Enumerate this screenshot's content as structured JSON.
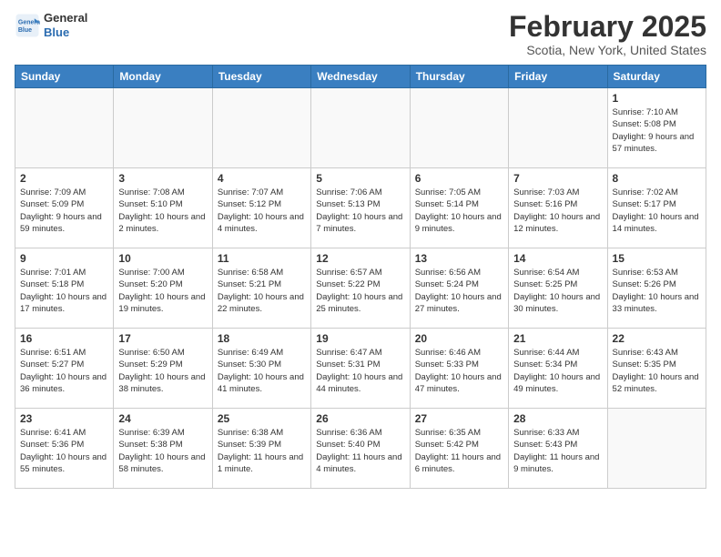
{
  "header": {
    "logo_line1": "General",
    "logo_line2": "Blue",
    "month_title": "February 2025",
    "location": "Scotia, New York, United States"
  },
  "weekdays": [
    "Sunday",
    "Monday",
    "Tuesday",
    "Wednesday",
    "Thursday",
    "Friday",
    "Saturday"
  ],
  "weeks": [
    [
      {
        "day": "",
        "info": ""
      },
      {
        "day": "",
        "info": ""
      },
      {
        "day": "",
        "info": ""
      },
      {
        "day": "",
        "info": ""
      },
      {
        "day": "",
        "info": ""
      },
      {
        "day": "",
        "info": ""
      },
      {
        "day": "1",
        "info": "Sunrise: 7:10 AM\nSunset: 5:08 PM\nDaylight: 9 hours and 57 minutes."
      }
    ],
    [
      {
        "day": "2",
        "info": "Sunrise: 7:09 AM\nSunset: 5:09 PM\nDaylight: 9 hours and 59 minutes."
      },
      {
        "day": "3",
        "info": "Sunrise: 7:08 AM\nSunset: 5:10 PM\nDaylight: 10 hours and 2 minutes."
      },
      {
        "day": "4",
        "info": "Sunrise: 7:07 AM\nSunset: 5:12 PM\nDaylight: 10 hours and 4 minutes."
      },
      {
        "day": "5",
        "info": "Sunrise: 7:06 AM\nSunset: 5:13 PM\nDaylight: 10 hours and 7 minutes."
      },
      {
        "day": "6",
        "info": "Sunrise: 7:05 AM\nSunset: 5:14 PM\nDaylight: 10 hours and 9 minutes."
      },
      {
        "day": "7",
        "info": "Sunrise: 7:03 AM\nSunset: 5:16 PM\nDaylight: 10 hours and 12 minutes."
      },
      {
        "day": "8",
        "info": "Sunrise: 7:02 AM\nSunset: 5:17 PM\nDaylight: 10 hours and 14 minutes."
      }
    ],
    [
      {
        "day": "9",
        "info": "Sunrise: 7:01 AM\nSunset: 5:18 PM\nDaylight: 10 hours and 17 minutes."
      },
      {
        "day": "10",
        "info": "Sunrise: 7:00 AM\nSunset: 5:20 PM\nDaylight: 10 hours and 19 minutes."
      },
      {
        "day": "11",
        "info": "Sunrise: 6:58 AM\nSunset: 5:21 PM\nDaylight: 10 hours and 22 minutes."
      },
      {
        "day": "12",
        "info": "Sunrise: 6:57 AM\nSunset: 5:22 PM\nDaylight: 10 hours and 25 minutes."
      },
      {
        "day": "13",
        "info": "Sunrise: 6:56 AM\nSunset: 5:24 PM\nDaylight: 10 hours and 27 minutes."
      },
      {
        "day": "14",
        "info": "Sunrise: 6:54 AM\nSunset: 5:25 PM\nDaylight: 10 hours and 30 minutes."
      },
      {
        "day": "15",
        "info": "Sunrise: 6:53 AM\nSunset: 5:26 PM\nDaylight: 10 hours and 33 minutes."
      }
    ],
    [
      {
        "day": "16",
        "info": "Sunrise: 6:51 AM\nSunset: 5:27 PM\nDaylight: 10 hours and 36 minutes."
      },
      {
        "day": "17",
        "info": "Sunrise: 6:50 AM\nSunset: 5:29 PM\nDaylight: 10 hours and 38 minutes."
      },
      {
        "day": "18",
        "info": "Sunrise: 6:49 AM\nSunset: 5:30 PM\nDaylight: 10 hours and 41 minutes."
      },
      {
        "day": "19",
        "info": "Sunrise: 6:47 AM\nSunset: 5:31 PM\nDaylight: 10 hours and 44 minutes."
      },
      {
        "day": "20",
        "info": "Sunrise: 6:46 AM\nSunset: 5:33 PM\nDaylight: 10 hours and 47 minutes."
      },
      {
        "day": "21",
        "info": "Sunrise: 6:44 AM\nSunset: 5:34 PM\nDaylight: 10 hours and 49 minutes."
      },
      {
        "day": "22",
        "info": "Sunrise: 6:43 AM\nSunset: 5:35 PM\nDaylight: 10 hours and 52 minutes."
      }
    ],
    [
      {
        "day": "23",
        "info": "Sunrise: 6:41 AM\nSunset: 5:36 PM\nDaylight: 10 hours and 55 minutes."
      },
      {
        "day": "24",
        "info": "Sunrise: 6:39 AM\nSunset: 5:38 PM\nDaylight: 10 hours and 58 minutes."
      },
      {
        "day": "25",
        "info": "Sunrise: 6:38 AM\nSunset: 5:39 PM\nDaylight: 11 hours and 1 minute."
      },
      {
        "day": "26",
        "info": "Sunrise: 6:36 AM\nSunset: 5:40 PM\nDaylight: 11 hours and 4 minutes."
      },
      {
        "day": "27",
        "info": "Sunrise: 6:35 AM\nSunset: 5:42 PM\nDaylight: 11 hours and 6 minutes."
      },
      {
        "day": "28",
        "info": "Sunrise: 6:33 AM\nSunset: 5:43 PM\nDaylight: 11 hours and 9 minutes."
      },
      {
        "day": "",
        "info": ""
      }
    ]
  ]
}
